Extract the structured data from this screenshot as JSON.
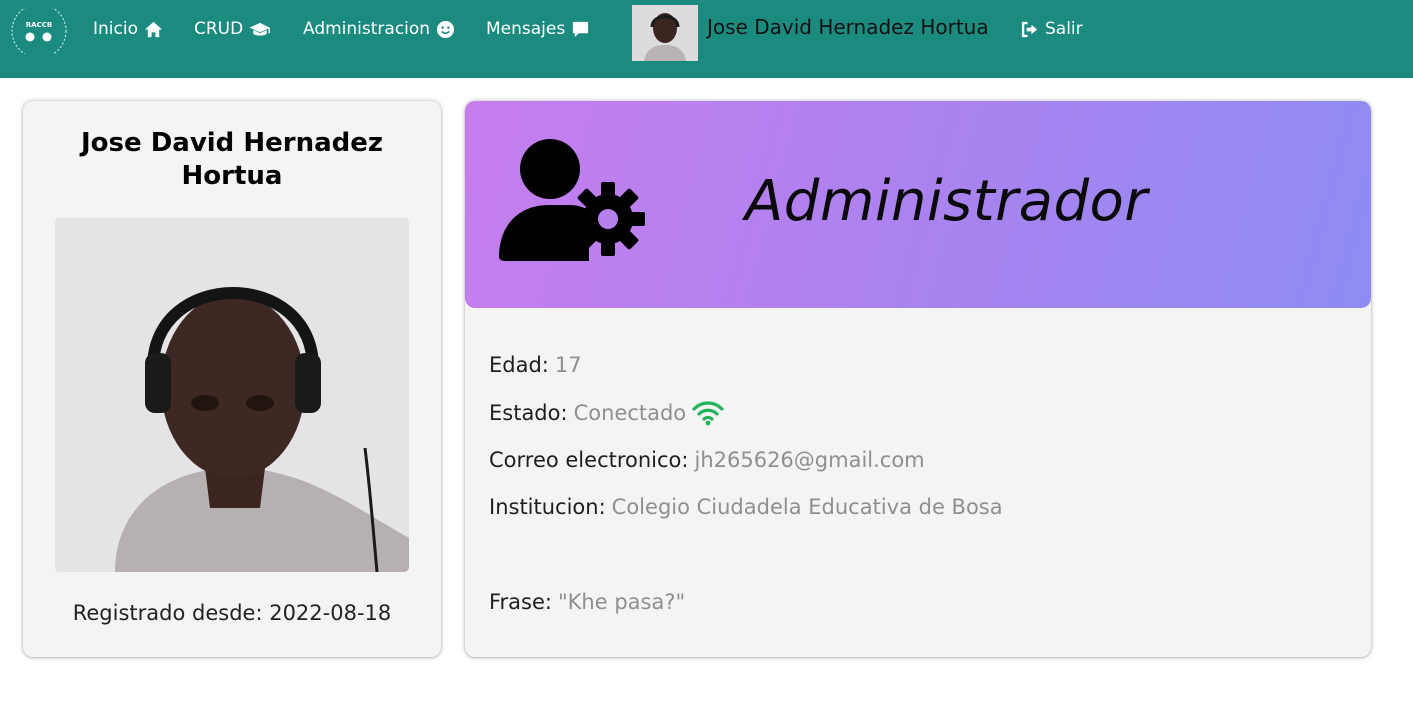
{
  "navbar": {
    "logo_text": "RACCB",
    "items": [
      {
        "label": "Inicio",
        "icon": "home-icon"
      },
      {
        "label": "CRUD",
        "icon": "graduation-cap-icon"
      },
      {
        "label": "Administracion",
        "icon": "smile-icon"
      },
      {
        "label": "Mensajes",
        "icon": "comment-icon"
      }
    ],
    "username": "Jose David Hernadez Hortua",
    "logout_label": "Salir",
    "logout_icon": "sign-out-icon",
    "background_color": "#1b8b80"
  },
  "profile": {
    "name": "Jose David Hernadez Hortua",
    "registered_label": "Registrado desde:",
    "registered_date": "2022-08-18"
  },
  "role": {
    "title": "Administrador",
    "icon": "user-gear-icon"
  },
  "info": {
    "age_label": "Edad:",
    "age_value": "17",
    "status_label": "Estado:",
    "status_value": "Conectado",
    "status_icon": "wifi-icon",
    "status_icon_color": "#23b25a",
    "email_label": "Correo electronico:",
    "email_value": "jh265626@gmail.com",
    "institution_label": "Institucion:",
    "institution_value": "Colegio Ciudadela Educativa de Bosa",
    "phrase_label": "Frase:",
    "phrase_value": "\"Khe pasa?\""
  }
}
